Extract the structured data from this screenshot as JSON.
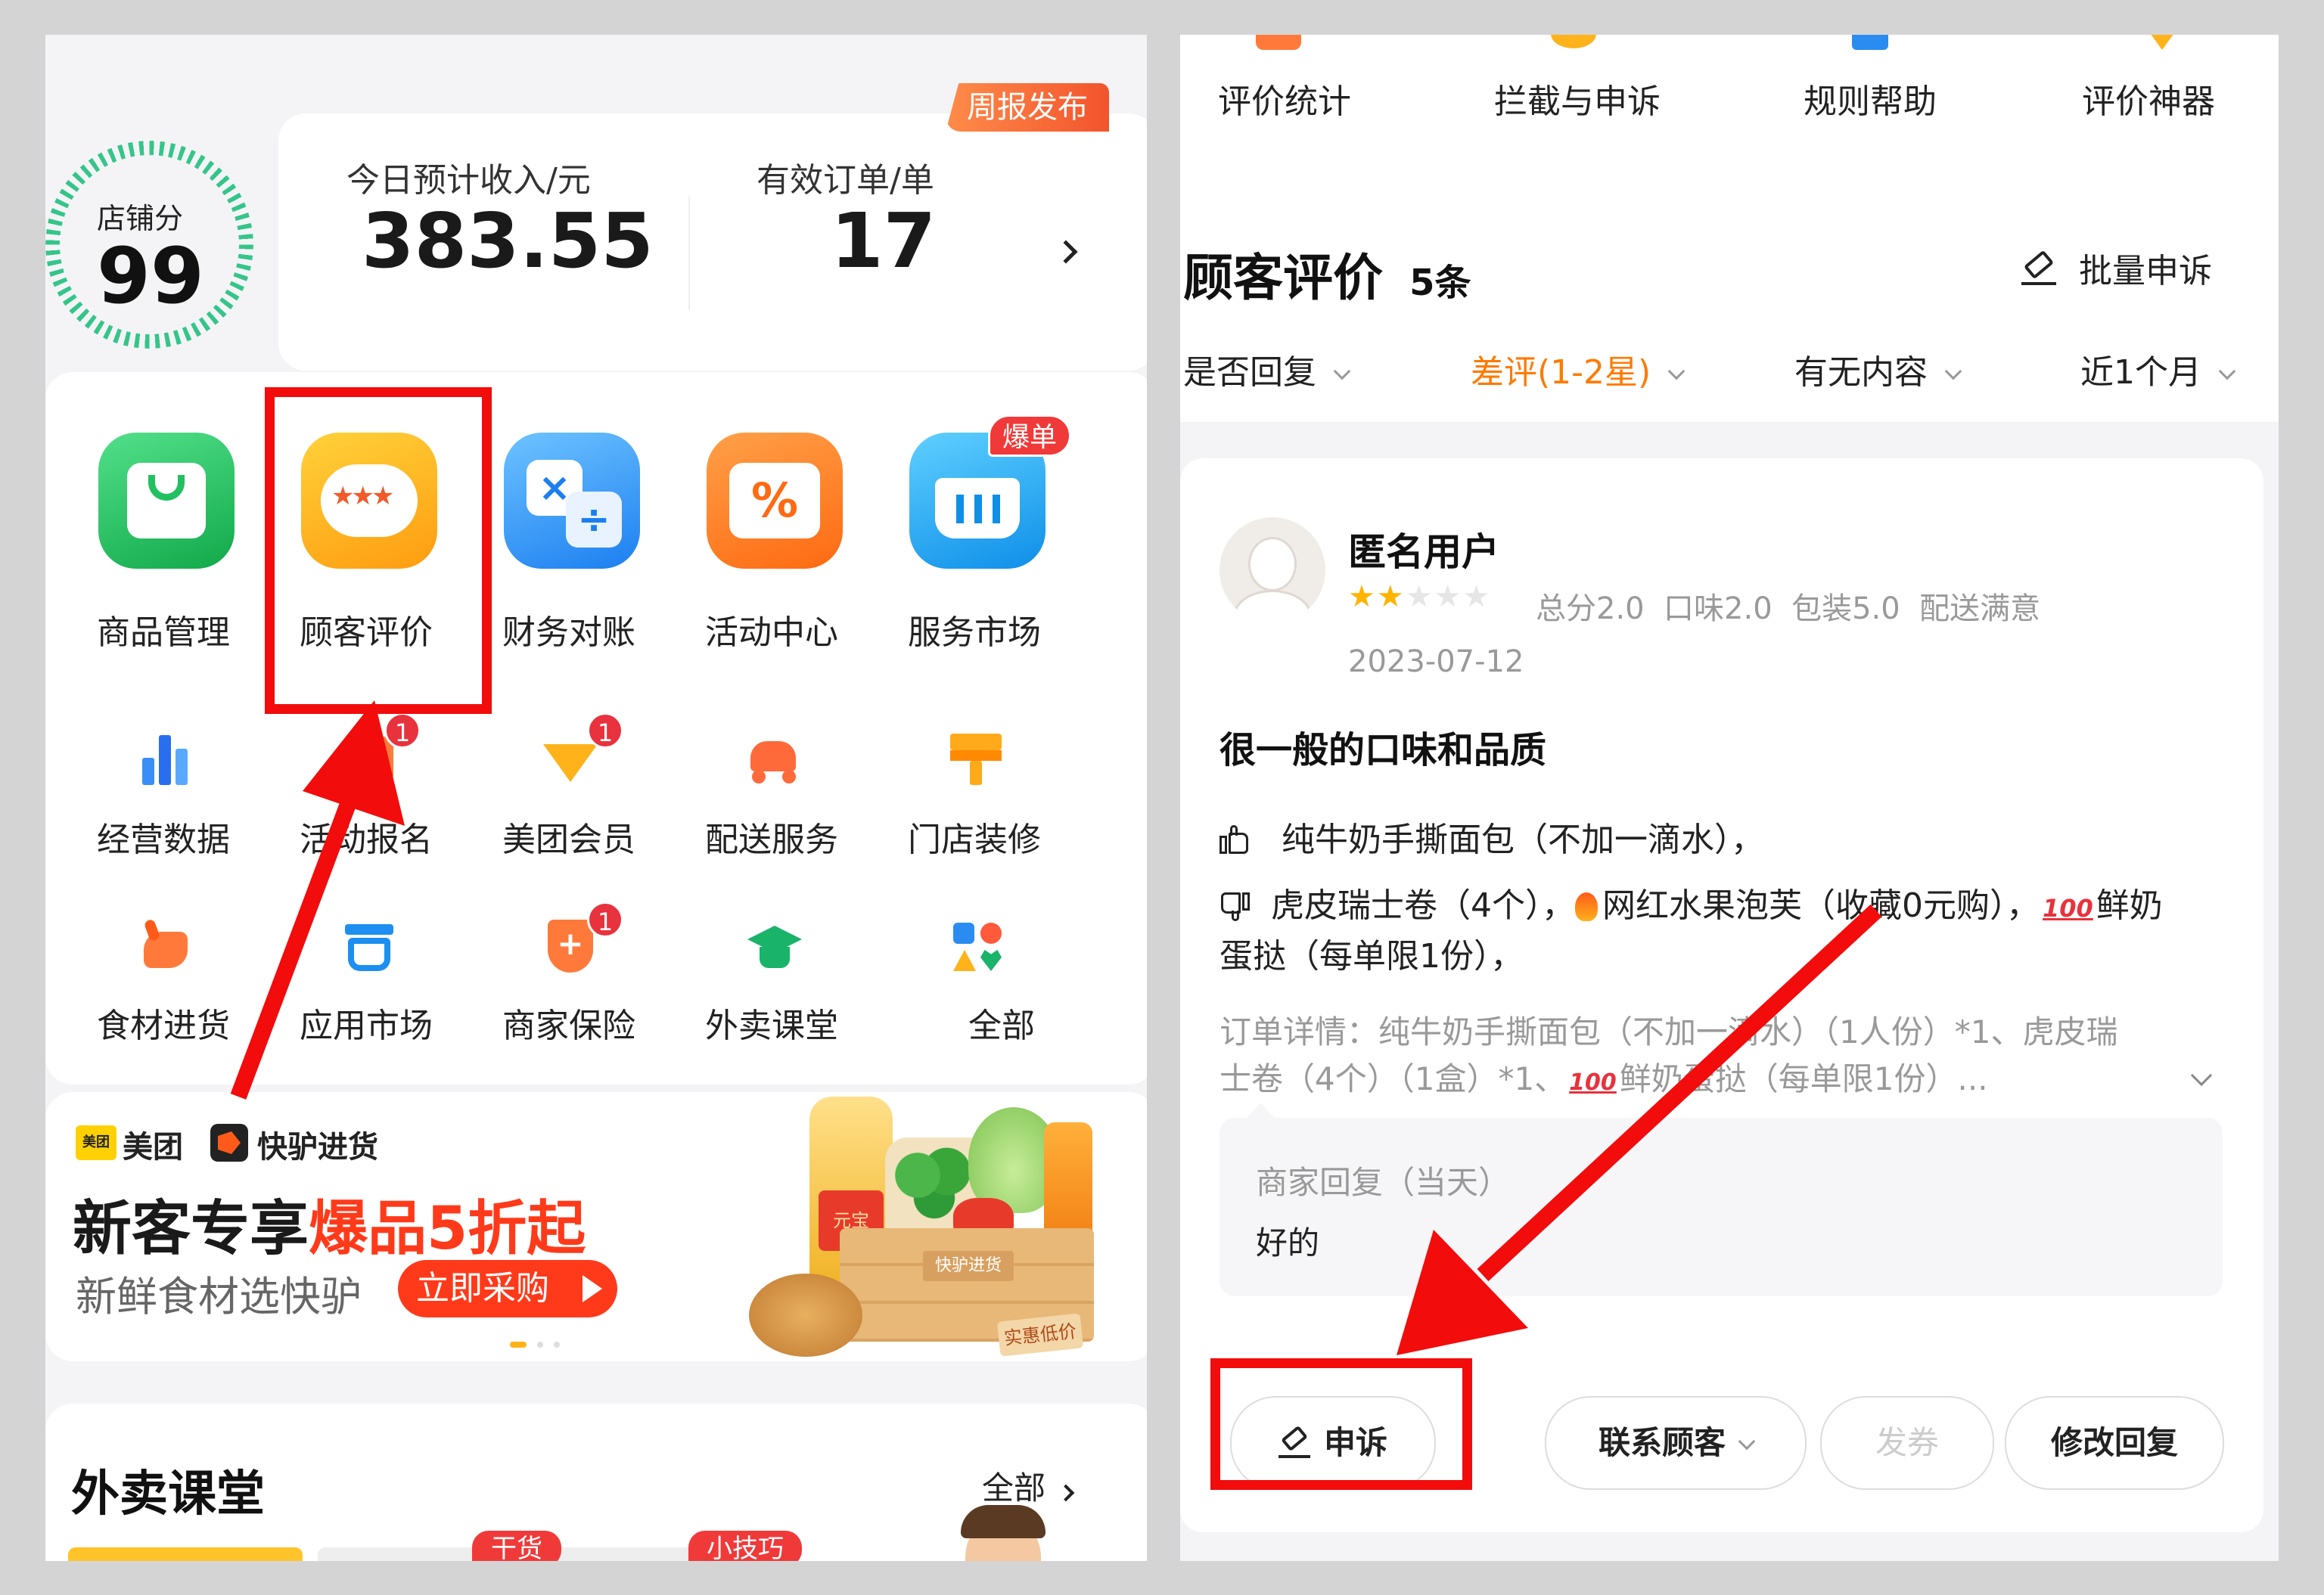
{
  "left": {
    "weekly_report": "周报发布",
    "store_score_label": "店铺分",
    "store_score": "99",
    "income_label": "今日预计收入/元",
    "income_value": "383.55",
    "orders_label": "有效订单/单",
    "orders_value": "17",
    "hot_badge": "爆单",
    "big_icons": [
      {
        "label": "商品管理",
        "icon": "shopping-bag-icon",
        "color": "#21c060"
      },
      {
        "label": "顾客评价",
        "icon": "review-bubble-icon",
        "color": "#ffb216"
      },
      {
        "label": "财务对账",
        "icon": "calculator-icon",
        "color": "#2a8cf0"
      },
      {
        "label": "活动中心",
        "icon": "coupon-percent-icon",
        "color": "#ff7a1a"
      },
      {
        "label": "服务市场",
        "icon": "basket-icon",
        "color": "#1a9ef5"
      }
    ],
    "small_icons_row1": [
      {
        "label": "经营数据",
        "icon": "bar-chart-icon",
        "badge": ""
      },
      {
        "label": "活动报名",
        "icon": "activity-icon",
        "badge": "1"
      },
      {
        "label": "美团会员",
        "icon": "member-icon",
        "badge": "1"
      },
      {
        "label": "配送服务",
        "icon": "delivery-icon",
        "badge": ""
      },
      {
        "label": "门店装修",
        "icon": "paint-brush-icon",
        "badge": ""
      }
    ],
    "small_icons_row2": [
      {
        "label": "食材进货",
        "icon": "donkey-icon",
        "badge": ""
      },
      {
        "label": "应用市场",
        "icon": "app-market-icon",
        "badge": ""
      },
      {
        "label": "商家保险",
        "icon": "shield-icon",
        "badge": "1"
      },
      {
        "label": "外卖课堂",
        "icon": "graduation-cap-icon",
        "badge": ""
      },
      {
        "label": "全部",
        "icon": "all-apps-icon",
        "badge": ""
      }
    ],
    "banner": {
      "brand1": "美团",
      "brand1_logo": "美团",
      "brand2": "快驴进货",
      "headline_black": "新客专享",
      "headline_red": "爆品5折起",
      "sub": "新鲜食材选快驴",
      "cta": "立即采购",
      "box_text": "快驴进货",
      "tag_text": "实惠低价",
      "oil_label": "元宝"
    },
    "course": {
      "title": "外卖课堂",
      "all": "全部",
      "tag1": "干货",
      "tag2": "小技巧"
    }
  },
  "right": {
    "top_tabs": [
      "评价统计",
      "拦截与申诉",
      "规则帮助",
      "评价神器"
    ],
    "section_title": "顾客评价",
    "count": "5条",
    "batch_appeal": "批量申诉",
    "filters": [
      {
        "label": "是否回复",
        "active": false
      },
      {
        "label": "差评(1-2星)",
        "active": true
      },
      {
        "label": "有无内容",
        "active": false
      },
      {
        "label": "近1个月",
        "active": false
      }
    ],
    "review": {
      "user": "匿名用户",
      "stars": 2,
      "total_stars": 5,
      "scores": "总分2.0  口味2.0  包装5.0  配送满意",
      "date": "2023-07-12",
      "content": "很一般的口味和品质",
      "like_text": "纯牛奶手撕面包（不加一滴水），",
      "dislike_text_1": "虎皮瑞士卷（4个），",
      "dislike_text_2": "网红水果泡芙（收藏0元购），",
      "dislike_text_3": "鲜奶",
      "dislike_text_4": "蛋挞（每单限1份），",
      "order_line1": "订单详情：纯牛奶手撕面包（不加一滴水）（1人份）*1、虎皮瑞",
      "order_line2a": "士卷（4个）（1盒）*1、",
      "order_line2b": "鲜奶蛋挞（每单限1份）...",
      "merchant_reply_label": "商家回复（当天）",
      "merchant_reply": "好的"
    },
    "actions": {
      "appeal": "申诉",
      "contact": "联系顾客",
      "coupon": "发券",
      "edit_reply": "修改回复"
    },
    "colors": {
      "accent": "#ff7a00",
      "red_annotation": "#f20c0c"
    }
  }
}
